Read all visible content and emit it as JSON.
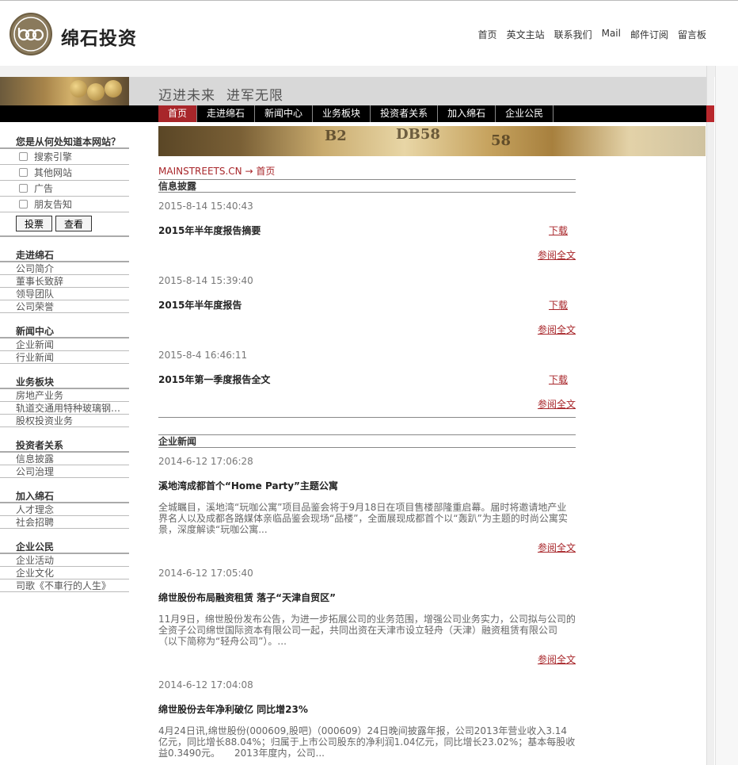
{
  "brand": {
    "name": "绵石投资"
  },
  "topnav": [
    "首页",
    "英文主站",
    "联系我们",
    "Mail",
    "邮件订阅",
    "留言板"
  ],
  "slogan": [
    "迈进未来",
    "进军无限"
  ],
  "mainnav": [
    "首页",
    "走进绵石",
    "新闻中心",
    "业务板块",
    "投资者关系",
    "加入绵石",
    "企业公民"
  ],
  "survey": {
    "question": "您是从何处知道本网站？",
    "options": [
      "搜索引擎",
      "其他网站",
      "广告",
      "朋友告知"
    ],
    "vote_label": "投票",
    "view_label": "查看"
  },
  "sidebar": [
    {
      "title": "走进绵石",
      "links": [
        "公司简介",
        "董事长致辞",
        "领导团队",
        "公司荣誉"
      ]
    },
    {
      "title": "新闻中心",
      "links": [
        "企业新闻",
        "行业新闻"
      ]
    },
    {
      "title": "业务板块",
      "links": [
        "房地产业务",
        "轨道交通用特种玻璃钢研...",
        "股权投资业务"
      ]
    },
    {
      "title": "投资者关系",
      "links": [
        "信息披露",
        "公司治理"
      ]
    },
    {
      "title": "加入绵石",
      "links": [
        "人才理念",
        "社会招聘"
      ]
    },
    {
      "title": "企业公民",
      "links": [
        "企业活动",
        "企业文化",
        "司歌《不車行的人生》"
      ]
    }
  ],
  "breadcrumb": {
    "site": "MAINSTREETS.CN",
    "arrow": "→",
    "page": "首页"
  },
  "disclosure": {
    "title": "信息披露",
    "download_label": "下载",
    "more_label": "参阅全文",
    "items": [
      {
        "date": "2015-8-14 15:40:43",
        "title": "2015年半年度报告摘要"
      },
      {
        "date": "2015-8-14 15:39:40",
        "title": "2015年半年度报告"
      },
      {
        "date": "2015-8-4 16:46:11",
        "title": "2015年第一季度报告全文"
      }
    ]
  },
  "news": {
    "title": "企业新闻",
    "more_label": "参阅全文",
    "items": [
      {
        "date": "2014-6-12 17:06:28",
        "title": "溪地湾成都首个“Home Party”主题公寓",
        "summary": "全城瞩目，溪地湾“玩咖公寓”项目品鉴会将于9月18日在项目售楼部隆重启幕。届时将邀请地产业界名人以及成都各路媒体亲临品鉴会现场“品楼”，全面展现成都首个以“轰趴”为主题的时尚公寓实景，深度解读“玩咖公寓..."
      },
      {
        "date": "2014-6-12 17:05:40",
        "title": "绵世股份布局融资租赁 落子“天津自贸区”",
        "summary": "11月9日，绵世股份发布公告，为进一步拓展公司的业务范围，增强公司业务实力，公司拟与公司的全资子公司绵世国际资本有限公司一起，共同出资在天津市设立轻舟（天津）融资租赁有限公司（以下简称为“轻舟公司”）。..."
      },
      {
        "date": "2014-6-12 17:04:08",
        "title": "绵世股份去年净利破亿 同比增23%",
        "summary": "4月24日讯,绵世股份(000609,股吧)（000609）24日晚间披露年报，公司2013年营业收入3.14亿元，同比增长88.04%；归属于上市公司股东的净利润1.04亿元，同比增长23.02%；基本每股收益0.3490元。　　2013年度内，公司..."
      }
    ]
  },
  "colors": {
    "accent": "#a8262a",
    "nav_bg": "#000000",
    "slogan_bg": "#d8d8d8"
  }
}
